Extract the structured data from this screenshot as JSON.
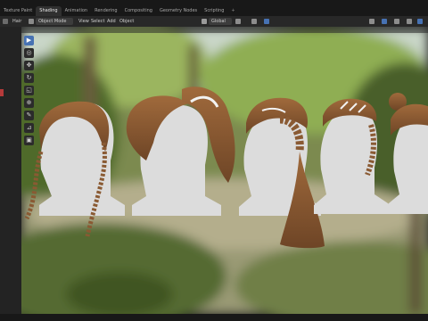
{
  "workspace_tabs": [
    "Texture Paint",
    "Shading",
    "Animation",
    "Rendering",
    "Compositing",
    "Geometry Nodes",
    "Scripting",
    "+"
  ],
  "active_tab": "Shading",
  "header": {
    "object_label": "Hair",
    "mode": "Object Mode",
    "menus": [
      "View",
      "Select",
      "Add",
      "Object"
    ],
    "orientation": "Global"
  },
  "viewport": {
    "content": "Five bald white head mannequins (rear/side views) each wearing a brown braided hairstyle, rendered against a blurred green forest backdrop",
    "hairstyles": 5,
    "hair_color": "#8a5a33",
    "head_color": "#dcdcdc"
  },
  "tools": [
    "select-box",
    "cursor",
    "move",
    "rotate",
    "scale",
    "transform",
    "annotate",
    "measure",
    "add-cube"
  ],
  "colors": {
    "ui_dark": "#1d1d1d",
    "header": "#282828",
    "accent_blue": "#4772b3",
    "hair": "#8a5a33",
    "mannequin": "#dcdcdc"
  }
}
